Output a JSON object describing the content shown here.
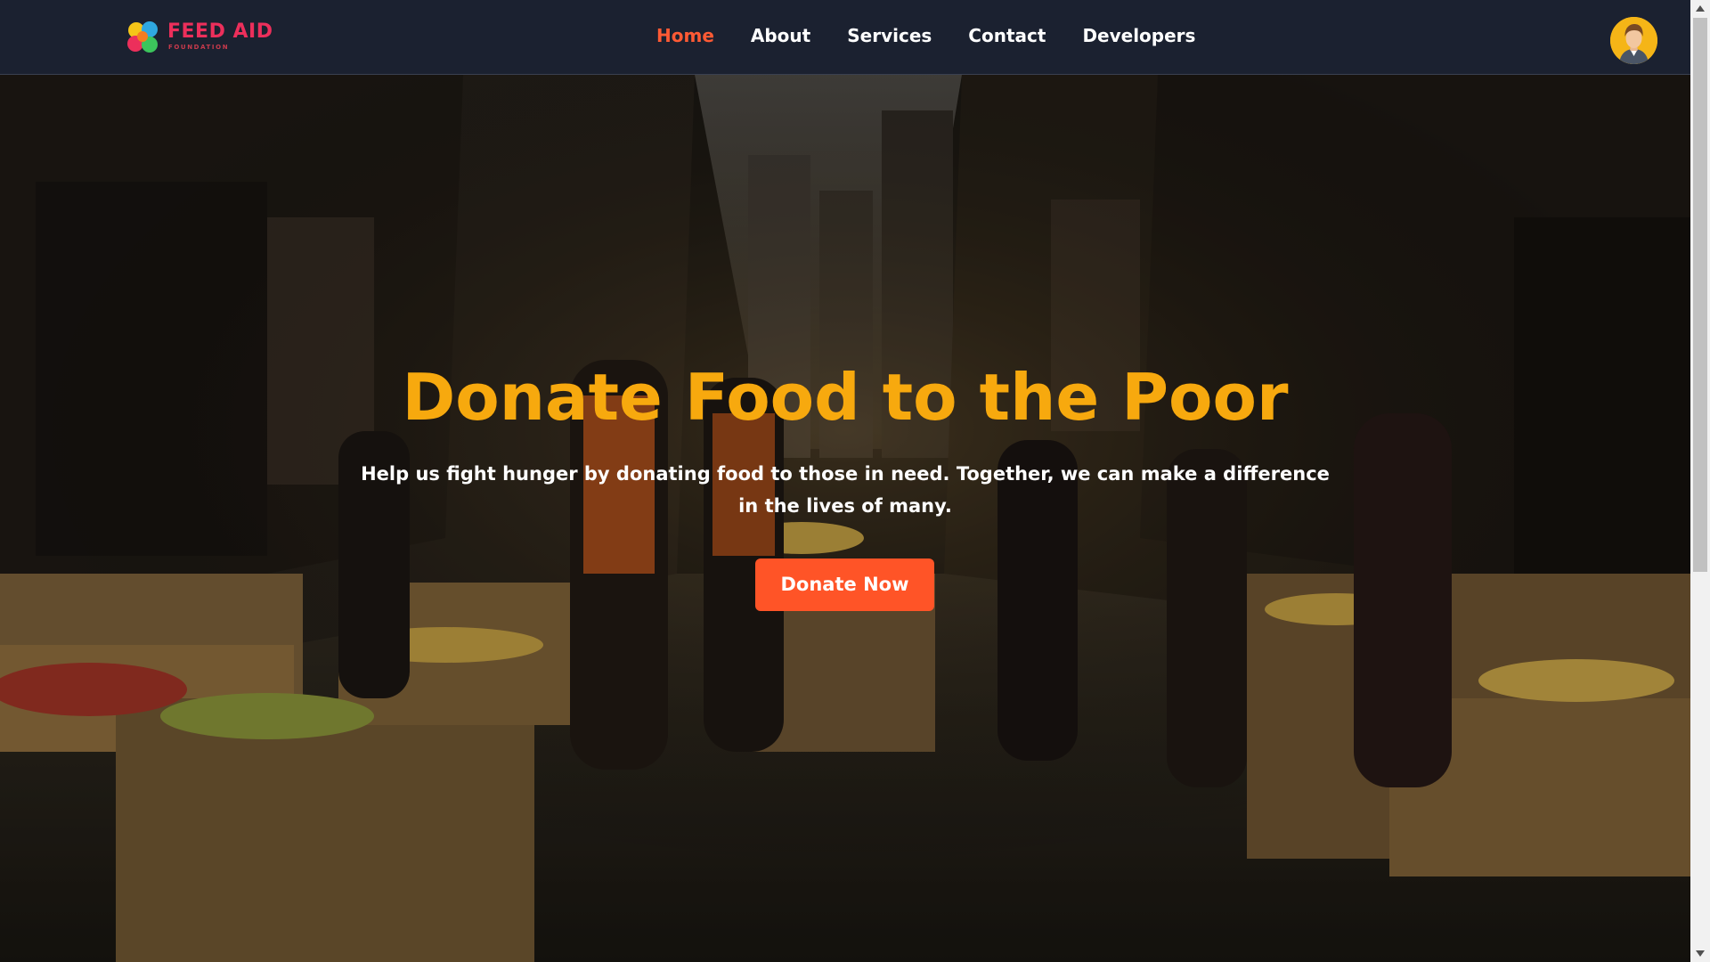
{
  "brand": {
    "name": "FEED AID",
    "tagline": "FOUNDATION",
    "logo_icon": "flower-logo-icon"
  },
  "nav": {
    "items": [
      {
        "label": "Home",
        "active": true
      },
      {
        "label": "About",
        "active": false
      },
      {
        "label": "Services",
        "active": false
      },
      {
        "label": "Contact",
        "active": false
      },
      {
        "label": "Developers",
        "active": false
      }
    ],
    "avatar_icon": "user-avatar-icon"
  },
  "hero": {
    "title": "Donate Food to the Poor",
    "text": "Help us fight hunger by donating food to those in need. Together, we can make a difference in the lives of many.",
    "cta_label": "Donate Now",
    "background": "street food distribution photo"
  },
  "colors": {
    "nav_bg": "#1b2130",
    "accent": "#ff5427",
    "active_nav": "#ff5a34",
    "title": "#f7a90e",
    "brand": "#ec2f5b",
    "avatar_bg": "#f5b517"
  },
  "scrollbar": {
    "up_icon": "scroll-up-arrow-icon",
    "down_icon": "scroll-down-arrow-icon"
  }
}
